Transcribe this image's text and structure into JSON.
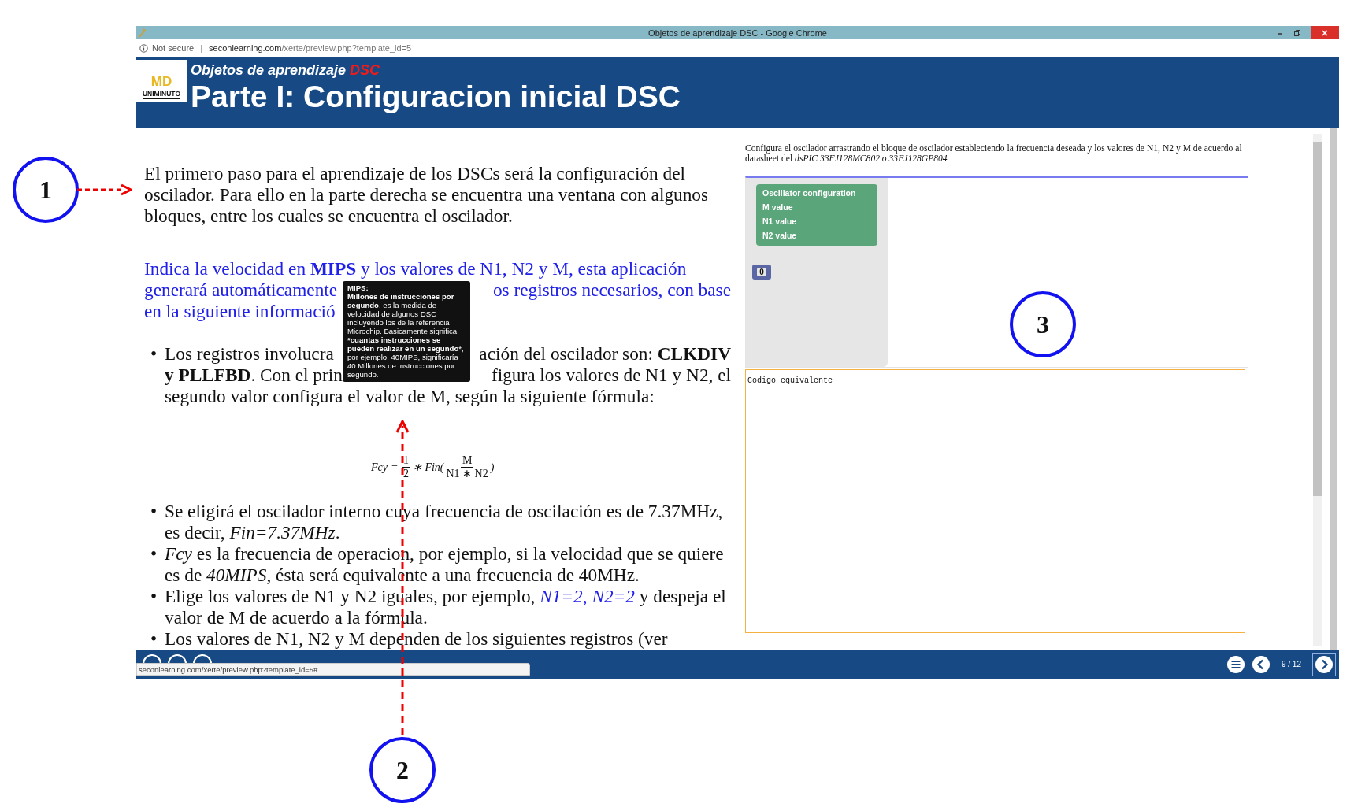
{
  "window": {
    "title": "Objetos de aprendizaje DSC - Google Chrome"
  },
  "address_bar": {
    "security": "Not secure",
    "separator": "|",
    "domain": "seconlearning.com",
    "path": "/xerte/preview.php?template_id=5"
  },
  "header": {
    "logo_mark": "MD",
    "logo_name": "UNIMINUTO",
    "subtitle": "Objetos de aprendizaje",
    "subtitle_highlight": "DSC",
    "title": "Parte I: Configuracion inicial DSC"
  },
  "left": {
    "intro": "El primero paso para el aprendizaje de los DSCs será la configuración del oscilador. Para ello en la parte derecha se encuentra una ventana con algunos bloques, entre los cuales se encuentra el oscilador.",
    "instruction_lines": [
      {
        "left": "Indica la velocidad en **MIPS** y los valores de N1, N2 y M, esta aplicación"
      },
      {
        "left": "generará automáticamente",
        "right": "os registros necesarios, con base"
      },
      {
        "left": "en la siguiente informació"
      }
    ],
    "bullet_marker": "•",
    "bullet_lines": [
      {
        "left": "Los registros involucra",
        "right": "ación del oscilador son: **CLKDIV**"
      },
      {
        "left": "**y PLLFBD**. Con el prin",
        "right": "figura los valores de N1 y N2, el"
      },
      {
        "left": "segundo valor configura el valor de M, según la siguiente fórmula:"
      }
    ],
    "tooltip": {
      "title": "MIPS:",
      "body": "**Millones de instrucciones por segundo**, es la medida de velocidad de algunos DSC incluyendo los de la referencia Microchip. Basicamente significa ***cuantas instrucciones se pueden realizar en un segundo***, por ejemplo, 40MIPS, significaría 40 Millones de instrucciones por segundo."
    },
    "formula": {
      "lhs": "Fcy",
      "eq": "=",
      "num1": "1",
      "den1": "2",
      "mid": "∗ Fin(",
      "num2": "M",
      "den2": "N1 ∗ N2",
      "close": ")"
    },
    "bullets": [
      {
        "marker": "•",
        "segments": [
          {
            "kind": "plain",
            "text": "Se eligirá el oscilador interno cuya frecuencia de oscilación es de 7.37MHz, es decir, "
          },
          {
            "kind": "italic",
            "text": "Fin=7.37MHz"
          },
          {
            "kind": "plain",
            "text": "."
          }
        ]
      },
      {
        "marker": "•",
        "segments": [
          {
            "kind": "italic",
            "text": "Fcy"
          },
          {
            "kind": "plain",
            "text": " es la frecuencia de operacion, por ejemplo, si la velocidad que se quiere es de "
          },
          {
            "kind": "italic",
            "text": "40MIPS"
          },
          {
            "kind": "plain",
            "text": ", ésta será equivalente a una frecuencia de 40MHz."
          }
        ]
      },
      {
        "marker": "•",
        "segments": [
          {
            "kind": "plain",
            "text": "Elige los valores de N1 y N2 iguales, por ejemplo, "
          },
          {
            "kind": "link",
            "text": "N1=2, N2=2"
          },
          {
            "kind": "plain",
            "text": " y despeja el valor de M de acuerdo a la fórmula."
          }
        ]
      },
      {
        "marker": "•",
        "segments": [
          {
            "kind": "plain",
            "text": "Los valores de N1, N2 y M dependen de los siguientes registros (ver"
          }
        ]
      }
    ]
  },
  "right": {
    "instructions": "Configura el oscilador arrastrando el bloque de oscilador estableciendo la frecuencia deseada y los valores de N1, N2 y M de acuerdo al datasheet del *dsPIC 33FJ128MC802 o 33FJ128GP804*",
    "block": {
      "title": "Oscillator configuration",
      "inputs": [
        "M value",
        "N1 value",
        "N2 value"
      ]
    },
    "number_block": "0",
    "code_label": "Codigo equivalente"
  },
  "footer": {
    "status_url": "seconlearning.com/xerte/preview.php?template_id=5#",
    "page": "9 / 12"
  },
  "annotations": [
    "1",
    "2",
    "3"
  ]
}
